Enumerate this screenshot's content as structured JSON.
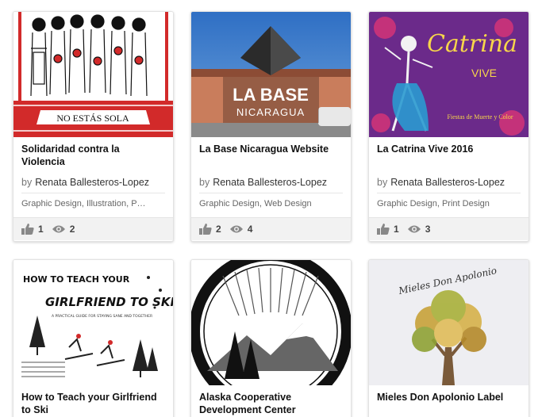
{
  "projects": [
    {
      "title": "Solidaridad contra la Violencia",
      "by": "by",
      "owner": "Renata Ballesteros-Lopez",
      "fields": [
        "Graphic Design",
        "Illustration",
        "P…"
      ],
      "appreciations": "1",
      "views": "2",
      "thumb_text": "NO ESTÁS SOLA"
    },
    {
      "title": "La Base Nicaragua Website",
      "by": "by",
      "owner": "Renata Ballesteros-Lopez",
      "fields": [
        "Graphic Design",
        "Web Design"
      ],
      "appreciations": "2",
      "views": "4",
      "thumb_text": "LA BASE",
      "thumb_subtext": "NICARAGUA"
    },
    {
      "title": "La Catrina Vive 2016",
      "by": "by",
      "owner": "Renata Ballesteros-Lopez",
      "fields": [
        "Graphic Design",
        "Print Design"
      ],
      "appreciations": "1",
      "views": "3",
      "thumb_text": "Catrina",
      "thumb_subtext": "VIVE",
      "thumb_caption": "Fiestas de Muerte y Color"
    },
    {
      "title": "How to Teach your Girlfriend to Ski",
      "thumb_text": "HOW TO TEACH YOUR",
      "thumb_subtext": "GIRLFRIEND TO SKI",
      "thumb_caption": "A PRACTICAL GUIDE FOR STAYING SANE AND TOGETHER"
    },
    {
      "title": "Alaska Cooperative Development Center"
    },
    {
      "title": "Mieles Don Apolonio Label",
      "thumb_text": "Mieles Don Apolonio"
    }
  ],
  "colors": {
    "card_border": "#e2e2e2",
    "stats_bg": "#f2f2f2",
    "red": "#d22a2a",
    "catrina_purple": "#6b2a8a",
    "sky_blue": "#3f7ec6"
  }
}
